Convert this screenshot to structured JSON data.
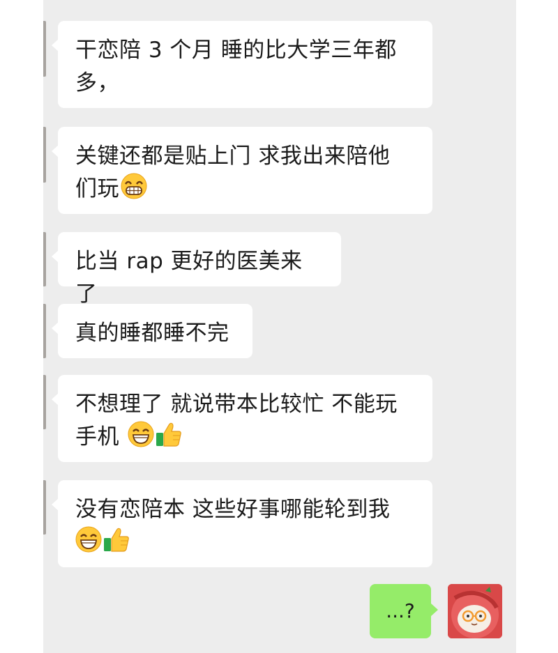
{
  "messages": [
    {
      "line1": "干恋陪 3 个月  睡的比大学三年都",
      "line2": "多，"
    },
    {
      "line1": "关键还都是贴上门  求我出来陪他",
      "line2": "们玩",
      "emoji": "grinning-face-icon"
    },
    {
      "line1": "比当 rap 更好的医美来了"
    },
    {
      "line1": "真的睡都睡不完"
    },
    {
      "line1": "不想理了  就说带本比较忙  不能玩",
      "line2": "手机",
      "emoji": "smiling-face-icon",
      "thumb": "thumbs-up-icon"
    },
    {
      "line1": "没有恋陪本  这些好事哪能轮到我",
      "emoji": "smiling-face-icon",
      "thumb": "thumbs-up-icon"
    }
  ],
  "sent": {
    "text": "...?"
  },
  "colors": {
    "chat_bg": "#ededed",
    "received_bubble": "#ffffff",
    "sent_bubble": "#95ec69",
    "emoji_yellow": "#ffc93a"
  }
}
